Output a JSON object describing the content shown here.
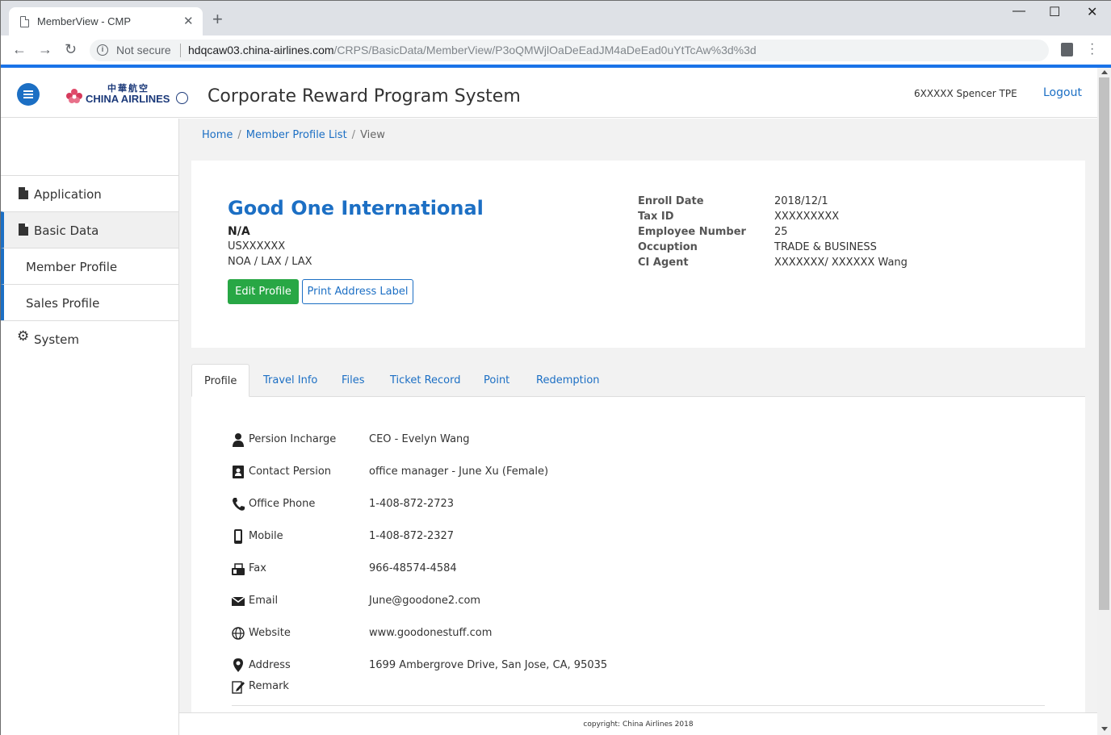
{
  "browser": {
    "tab_title": "MemberView - CMP",
    "tab_close": "✕",
    "new_tab": "+",
    "security_label": "Not secure",
    "url_host": "hdqcaw03.china-airlines.com",
    "url_path": "/CRPS/BasicData/MemberView/P3oQMWjlOaDeEadJM4aDeEad0uYtTcAw%3d%3d",
    "back_icon": "←",
    "forward_icon": "→",
    "reload_icon": "↻",
    "minimize_icon": "—",
    "maximize_icon": "☐",
    "close_window_icon": "✕"
  },
  "header": {
    "logo_cn": "中華航空",
    "logo_en": "CHINA AIRLINES",
    "title": "Corporate Reward Program System",
    "user": "6XXXXX Spencer TPE",
    "logout": "Logout"
  },
  "sidebar": {
    "items": [
      {
        "label": "Application"
      },
      {
        "label": "Basic Data"
      },
      {
        "label": "Member Profile"
      },
      {
        "label": "Sales Profile"
      },
      {
        "label": "System"
      }
    ]
  },
  "breadcrumb": {
    "home": "Home",
    "list": "Member Profile List",
    "current": "View",
    "separator": "/"
  },
  "member": {
    "name": "Good One International",
    "status": "N/A",
    "code": "USXXXXXX",
    "route": "NOA / LAX / LAX",
    "edit_button": "Edit Profile",
    "print_button": "Print Address Label",
    "details": [
      {
        "key": "Enroll Date",
        "value": "2018/12/1"
      },
      {
        "key": "Tax ID",
        "value": "XXXXXXXXX"
      },
      {
        "key": "Employee Number",
        "value": "25"
      },
      {
        "key": "Occuption",
        "value": "TRADE & BUSINESS"
      },
      {
        "key": "CI Agent",
        "value": "XXXXXXX/ XXXXXX Wang"
      }
    ]
  },
  "tabs": [
    {
      "label": "Profile"
    },
    {
      "label": "Travel Info"
    },
    {
      "label": "Files"
    },
    {
      "label": "Ticket Record"
    },
    {
      "label": "Point"
    },
    {
      "label": "Redemption"
    }
  ],
  "profile": [
    {
      "key": "Persion Incharge",
      "value": "CEO - Evelyn Wang",
      "icon": "person-icon"
    },
    {
      "key": "Contact Persion",
      "value": "office manager - June Xu (Female)",
      "icon": "contact-card-icon"
    },
    {
      "key": "Office Phone",
      "value": "1-408-872-2723",
      "icon": "phone-icon"
    },
    {
      "key": "Mobile",
      "value": "1-408-872-2327",
      "icon": "mobile-icon"
    },
    {
      "key": "Fax",
      "value": "966-48574-4584",
      "icon": "fax-icon"
    },
    {
      "key": "Email",
      "value": "June@goodone2.com",
      "icon": "envelope-icon"
    },
    {
      "key": "Website",
      "value": "www.goodonestuff.com",
      "icon": "globe-icon"
    },
    {
      "key": "Address",
      "value": "1699 Ambergrove Drive, San Jose, CA, 95035",
      "icon": "map-pin-icon"
    },
    {
      "key": "Remark",
      "value": "",
      "icon": "edit-note-icon"
    }
  ],
  "footer": {
    "copyright": "copyright: China Airlines 2018"
  },
  "colors": {
    "accent": "#1c6fc4",
    "success": "#28a745",
    "chrome_blue": "#1a73e8"
  }
}
